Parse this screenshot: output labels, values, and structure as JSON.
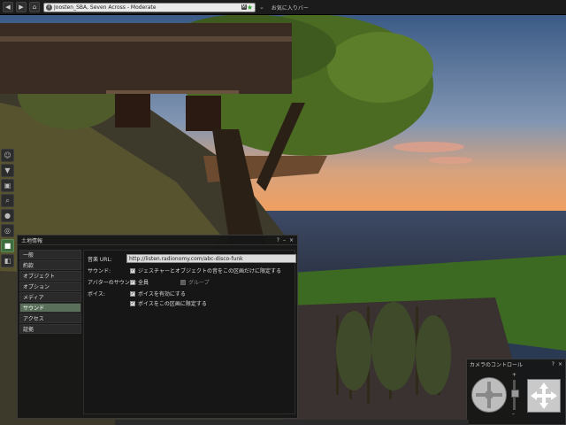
{
  "topbar": {
    "back_icon": "back-arrow-icon",
    "forward_icon": "forward-arrow-icon",
    "home_icon": "home-icon",
    "location": "Joosten_SBA, Seven Across - Moderate",
    "rating_badge": "M",
    "favorite_icon": "star-icon",
    "favorites_label": "お気に入りバー"
  },
  "left_toolbar": {
    "icons": [
      "people-icon",
      "shirt-icon",
      "inventory-icon",
      "search-icon",
      "lightbulb-icon",
      "compass-icon",
      "camera-icon",
      "map-icon"
    ],
    "active_index": 6
  },
  "land_dialog": {
    "title": "土地情報",
    "help": "?",
    "minimize": "–",
    "close": "×",
    "tabs": [
      "一般",
      "約款",
      "オブジェクト",
      "オプション",
      "メディア",
      "サウンド",
      "アクセス",
      "証拠"
    ],
    "selected_tab": 5,
    "music_url_label": "音楽 URL:",
    "music_url_value": "http://listen.radionomy.com/abc-disco-funk",
    "sound_label": "サウンド:",
    "sound_option": "ジェスチャーとオブジェクトの音をこの区画だけに限定する",
    "avatar_sound_label": "アバターのサウンド:",
    "avatar_sound_all": "全員",
    "avatar_sound_group": "グループ",
    "voice_label": "ボイス:",
    "voice_enable": "ボイスを有効にする",
    "voice_restrict": "ボイスをこの区画に限定する"
  },
  "camera_controls": {
    "title": "カメラのコントロール",
    "help": "?",
    "close": "×",
    "zoom_plus": "+",
    "zoom_minus": "–"
  }
}
